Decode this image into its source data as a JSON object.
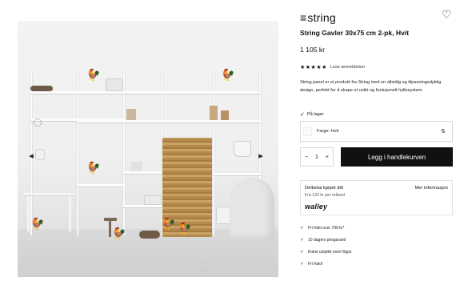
{
  "header": {
    "logo_text": "string",
    "heart_icon": "heart-outline-icon"
  },
  "product": {
    "title": "String Gavler 30x75 cm 2-pk, Hvit",
    "price": "1 105 kr",
    "stars": "★★★★★",
    "reviews_link": "Lese anmeldelser",
    "description": "String panel er et produkt fra String med en allsidig og tilpasningsdyktig design, perfekt for å skape et unikt og funksjonelt hyllesystem.",
    "stock_status": "På lager"
  },
  "options": {
    "color_label": "Farge: Hvit",
    "swatch_color": "#fafafa"
  },
  "cart": {
    "qty_minus": "−",
    "qty_value": "1",
    "qty_plus": "+",
    "add_to_cart": "Legg i handlekurven"
  },
  "payment": {
    "heading": "Delbetal kjøpet ditt",
    "subtext": "Fra 132 kr per måned",
    "more_info": "Mer informasjon",
    "brand": "walley"
  },
  "usps": [
    "Fri frakt over 799 kr*",
    "10 dagers prisgaranti",
    "Enkel utsjekk med Vipps",
    "Fri frakt!"
  ],
  "gallery": {
    "prev": "◂",
    "next": "▸"
  },
  "colors": {
    "button_bg": "#111111",
    "button_text": "#ffffff",
    "border": "#d9d9d9"
  }
}
